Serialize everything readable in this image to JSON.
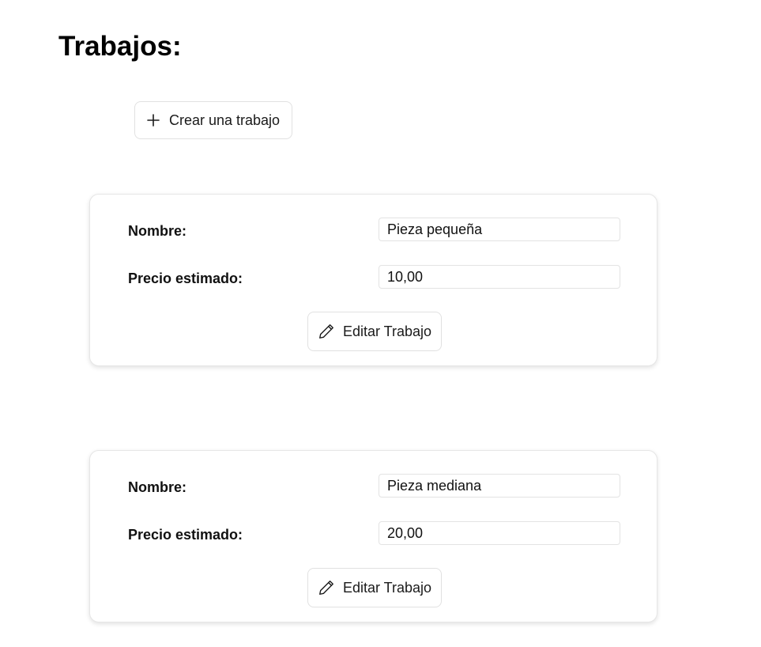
{
  "page": {
    "title": "Trabajos:"
  },
  "create_button": {
    "label": "Crear una trabajo",
    "icon": "plus-icon"
  },
  "jobs": [
    {
      "name_label": "Nombre:",
      "name_value": "Pieza pequeña",
      "price_label": "Precio estimado:",
      "price_value": "10,00",
      "edit_label": "Editar Trabajo",
      "edit_icon": "pencil-icon"
    },
    {
      "name_label": "Nombre:",
      "name_value": "Pieza mediana",
      "price_label": "Precio estimado:",
      "price_value": "20,00",
      "edit_label": "Editar Trabajo",
      "edit_icon": "pencil-icon"
    }
  ]
}
